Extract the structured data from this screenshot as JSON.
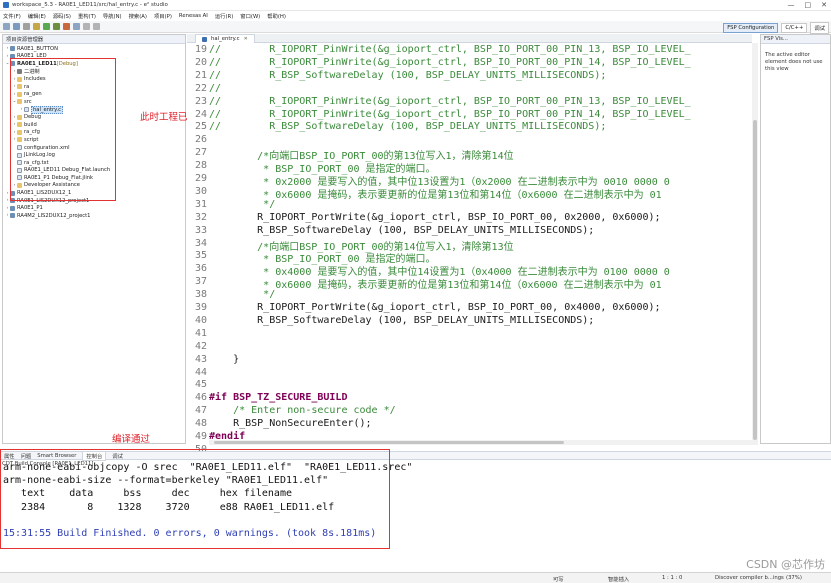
{
  "window": {
    "title": "workspace_5.3 - RA0E1_LED11/src/hal_entry.c - e² studio",
    "controls": [
      "—",
      "□",
      "✕"
    ]
  },
  "menu": [
    "文件(F)",
    "编辑(E)",
    "源码(S)",
    "重构(T)",
    "导航(N)",
    "搜索(A)",
    "项目(P)",
    "Renesas AI",
    "运行(R)",
    "窗口(W)",
    "帮助(H)"
  ],
  "perspectives": {
    "active": "FSP Configuration",
    "other": "C/C++",
    "extra": "调试"
  },
  "explorer": {
    "title": "项目资源管理器",
    "rows": [
      {
        "indent": 0,
        "twisty": "›",
        "icon": "proj",
        "label": "RA0E1_BUTTON"
      },
      {
        "indent": 0,
        "twisty": "›",
        "icon": "proj",
        "label": "RA0E1_LED"
      },
      {
        "indent": 0,
        "twisty": "⌄",
        "icon": "proj",
        "label": "RA0E1_LED11",
        "suffix": " [Debug]",
        "bold": true
      },
      {
        "indent": 1,
        "twisty": "›",
        "icon": "bin",
        "label": "二进制"
      },
      {
        "indent": 1,
        "twisty": "›",
        "icon": "fold",
        "label": "Includes"
      },
      {
        "indent": 1,
        "twisty": "›",
        "icon": "fold",
        "label": "ra"
      },
      {
        "indent": 1,
        "twisty": "›",
        "icon": "fold",
        "label": "ra_gen"
      },
      {
        "indent": 1,
        "twisty": "⌄",
        "icon": "fold",
        "label": "src"
      },
      {
        "indent": 2,
        "twisty": "›",
        "icon": "file",
        "label": "hal_entry.c",
        "selected": true
      },
      {
        "indent": 1,
        "twisty": "›",
        "icon": "fold",
        "label": "Debug"
      },
      {
        "indent": 1,
        "twisty": "›",
        "icon": "fold",
        "label": "build"
      },
      {
        "indent": 1,
        "twisty": "›",
        "icon": "fold",
        "label": "ra_cfg"
      },
      {
        "indent": 1,
        "twisty": "›",
        "icon": "fold",
        "label": "script"
      },
      {
        "indent": 1,
        "twisty": "",
        "icon": "file",
        "label": "configuration.xml"
      },
      {
        "indent": 1,
        "twisty": "",
        "icon": "file",
        "label": "JLinkLog.log"
      },
      {
        "indent": 1,
        "twisty": "",
        "icon": "file",
        "label": "ra_cfg.txt"
      },
      {
        "indent": 1,
        "twisty": "",
        "icon": "file",
        "label": "RA0E1_LED11 Debug_Flat.launch"
      },
      {
        "indent": 1,
        "twisty": "",
        "icon": "file",
        "label": "RA0E1_P1 Debug_Flat.jlink"
      },
      {
        "indent": 1,
        "twisty": "›",
        "icon": "fold",
        "label": "Developer Assistance"
      },
      {
        "indent": 0,
        "twisty": "›",
        "icon": "proj",
        "label": "RA0E1_LIS2DUX12_1"
      },
      {
        "indent": 0,
        "twisty": "›",
        "icon": "proj",
        "label": "RA0E1_LIS2DUX12_project1"
      },
      {
        "indent": 0,
        "twisty": "›",
        "icon": "proj",
        "label": "RA0E1_P1"
      },
      {
        "indent": 0,
        "twisty": "›",
        "icon": "proj",
        "label": "RA4M2_LIS2DUX12_project1"
      }
    ]
  },
  "annotations": {
    "import": "此时工程已经完整导入进来",
    "build": "编译通过"
  },
  "editor": {
    "tab_label": "hal_entry.c",
    "lines": [
      {
        "n": "19",
        "t": "//        R_IOPORT_PinWrite(&g_ioport_ctrl, BSP_IO_PORT_00_PIN_13, BSP_IO_LEVEL_"
      },
      {
        "n": "20",
        "t": "//        R_IOPORT_PinWrite(&g_ioport_ctrl, BSP_IO_PORT_00_PIN_14, BSP_IO_LEVEL_"
      },
      {
        "n": "21",
        "t": "//        R_BSP_SoftwareDelay (100, BSP_DELAY_UNITS_MILLISECONDS);"
      },
      {
        "n": "22",
        "t": "//"
      },
      {
        "n": "23",
        "t": "//        R_IOPORT_PinWrite(&g_ioport_ctrl, BSP_IO_PORT_00_PIN_13, BSP_IO_LEVEL_"
      },
      {
        "n": "24",
        "t": "//        R_IOPORT_PinWrite(&g_ioport_ctrl, BSP_IO_PORT_00_PIN_14, BSP_IO_LEVEL_"
      },
      {
        "n": "25",
        "t": "//        R_BSP_SoftwareDelay (100, BSP_DELAY_UNITS_MILLISECONDS);"
      },
      {
        "n": "26",
        "t": ""
      },
      {
        "n": "27",
        "t": "        /*向端口BSP_IO_PORT_00的第13位写入1，清除第14位"
      },
      {
        "n": "28",
        "t": "         * BSP_IO_PORT_00 是指定的端口。"
      },
      {
        "n": "29",
        "t": "         * 0x2000 是要写入的值，其中位13设置为1（0x2000 在二进制表示中为 0010 0000 0"
      },
      {
        "n": "30",
        "t": "         * 0x6000 是掩码，表示要更新的位是第13位和第14位（0x6000 在二进制表示中为 01"
      },
      {
        "n": "31",
        "t": "         */"
      },
      {
        "n": "32",
        "t": "        R_IOPORT_PortWrite(&g_ioport_ctrl, BSP_IO_PORT_00, 0x2000, 0x6000);"
      },
      {
        "n": "33",
        "t": "        R_BSP_SoftwareDelay (100, BSP_DELAY_UNITS_MILLISECONDS);"
      },
      {
        "n": "34",
        "t": "        /*向端口BSP_IO_PORT_00的第14位写入1，清除第13位"
      },
      {
        "n": "35",
        "t": "         * BSP_IO_PORT_00 是指定的端口。"
      },
      {
        "n": "36",
        "t": "         * 0x4000 是要写入的值，其中位14设置为1（0x4000 在二进制表示中为 0100 0000 0"
      },
      {
        "n": "37",
        "t": "         * 0x6000 是掩码，表示要更新的位是第13位和第14位（0x6000 在二进制表示中为 01"
      },
      {
        "n": "38",
        "t": "         */"
      },
      {
        "n": "39",
        "t": "        R_IOPORT_PortWrite(&g_ioport_ctrl, BSP_IO_PORT_00, 0x4000, 0x6000);"
      },
      {
        "n": "40",
        "t": "        R_BSP_SoftwareDelay (100, BSP_DELAY_UNITS_MILLISECONDS);"
      },
      {
        "n": "41",
        "t": ""
      },
      {
        "n": "42",
        "t": ""
      },
      {
        "n": "43",
        "t": "    }"
      },
      {
        "n": "44",
        "t": ""
      },
      {
        "n": "45",
        "t": ""
      },
      {
        "n": "46",
        "t": "#if BSP_TZ_SECURE_BUILD"
      },
      {
        "n": "47",
        "t": "    /* Enter non-secure code */"
      },
      {
        "n": "48",
        "t": "    R_BSP_NonSecureEnter();"
      },
      {
        "n": "49",
        "t": "#endif"
      },
      {
        "n": "50",
        "t": "}"
      }
    ]
  },
  "right_panel": {
    "title": "FSP Vis...",
    "message": "The active editor element does not use this view"
  },
  "console": {
    "tabs": [
      "属性",
      "问题",
      "Smart Browser",
      "控制台",
      "调试"
    ],
    "active_tab": "控制台",
    "title": "CDT Build Console [RA0E1_LED11]",
    "lines": [
      "arm-none-eabi-objcopy -O srec  \"RA0E1_LED11.elf\"  \"RA0E1_LED11.srec\"",
      "arm-none-eabi-size --format=berkeley \"RA0E1_LED11.elf\"",
      "   text    data     bss     dec     hex filename",
      "   2384       8    1328    3720     e88 RA0E1_LED11.elf",
      "",
      "15:31:55 Build Finished. 0 errors, 0 warnings. (took 8s.181ms)"
    ]
  },
  "status": {
    "writable": "可写",
    "insert": "智能插入",
    "position": "1 : 1 : 0",
    "progress": "Discover compiler b...ings",
    "percent": "(37%)"
  },
  "watermark": "CSDN @芯作坊"
}
